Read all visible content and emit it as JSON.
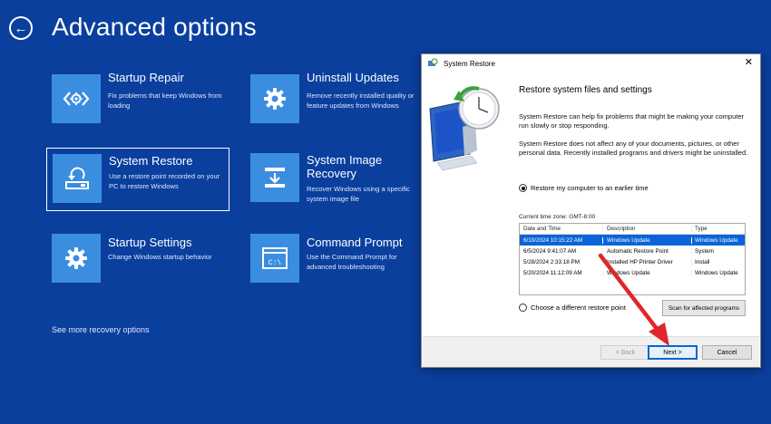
{
  "page": {
    "title": "Advanced options",
    "more_link": "See more recovery options"
  },
  "options": [
    {
      "title": "Startup Repair",
      "desc": "Fix problems that keep Windows from loading",
      "icon": "startup-repair-icon"
    },
    {
      "title": "Uninstall Updates",
      "desc": "Remove recently installed quality or feature updates from Windows",
      "icon": "gear-icon"
    },
    {
      "title": "System Restore",
      "desc": "Use a restore point recorded on your PC to restore Windows",
      "icon": "system-restore-icon"
    },
    {
      "title": "System Image Recovery",
      "desc": "Recover Windows using a specific system image file",
      "icon": "image-recovery-icon"
    },
    {
      "title": "Startup Settings",
      "desc": "Change Windows startup behavior",
      "icon": "gear-icon"
    },
    {
      "title": "Command Prompt",
      "desc": "Use the Command Prompt for advanced troubleshooting",
      "icon": "command-prompt-icon"
    }
  ],
  "cmd_glyph": "C:\\",
  "dialog": {
    "title": "System Restore",
    "heading": "Restore system files and settings",
    "para1": "System Restore can help fix problems that might be making your computer run slowly or stop responding.",
    "para2": "System Restore does not affect any of your documents, pictures, or other personal data. Recently installed programs and drivers might be uninstalled.",
    "radio_earlier": "Restore my computer to an earlier time",
    "timezone": "Current time zone: GMT-8:00",
    "columns": [
      "Date and Time",
      "Description",
      "Type"
    ],
    "rows": [
      {
        "date": "6/10/2024 10:15:22 AM",
        "desc": "Windows Update",
        "type": "Windows Update"
      },
      {
        "date": "6/5/2024 9:41:07 AM",
        "desc": "Automatic Restore Point",
        "type": "System"
      },
      {
        "date": "5/28/2024 2:33:18 PM",
        "desc": "Installed HP Printer Driver",
        "type": "Install"
      },
      {
        "date": "5/20/2024 11:12:09 AM",
        "desc": "Windows Update",
        "type": "Windows Update"
      }
    ],
    "radio_different": "Choose a different restore point",
    "scan_button": "Scan for affected programs",
    "back_button": "< Back",
    "next_button": "Next >",
    "cancel_button": "Cancel"
  },
  "colors": {
    "background": "#0a3f9e",
    "tile": "#3b8de0",
    "selection": "#0a64d8",
    "annotation_arrow": "#e0262b"
  }
}
